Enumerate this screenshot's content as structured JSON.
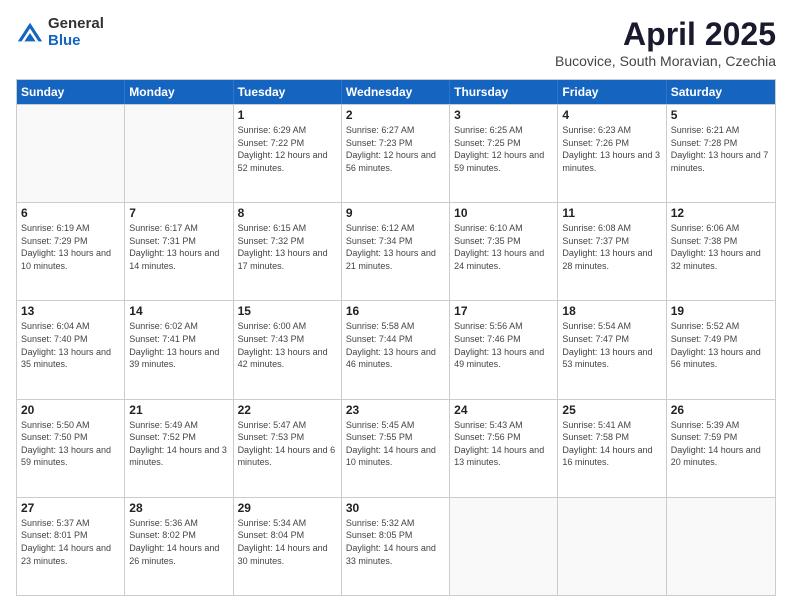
{
  "logo": {
    "general": "General",
    "blue": "Blue"
  },
  "title": "April 2025",
  "location": "Bucovice, South Moravian, Czechia",
  "days_header": [
    "Sunday",
    "Monday",
    "Tuesday",
    "Wednesday",
    "Thursday",
    "Friday",
    "Saturday"
  ],
  "weeks": [
    [
      {
        "day": "",
        "empty": true
      },
      {
        "day": "",
        "empty": true
      },
      {
        "day": "1",
        "sunrise": "Sunrise: 6:29 AM",
        "sunset": "Sunset: 7:22 PM",
        "daylight": "Daylight: 12 hours and 52 minutes."
      },
      {
        "day": "2",
        "sunrise": "Sunrise: 6:27 AM",
        "sunset": "Sunset: 7:23 PM",
        "daylight": "Daylight: 12 hours and 56 minutes."
      },
      {
        "day": "3",
        "sunrise": "Sunrise: 6:25 AM",
        "sunset": "Sunset: 7:25 PM",
        "daylight": "Daylight: 12 hours and 59 minutes."
      },
      {
        "day": "4",
        "sunrise": "Sunrise: 6:23 AM",
        "sunset": "Sunset: 7:26 PM",
        "daylight": "Daylight: 13 hours and 3 minutes."
      },
      {
        "day": "5",
        "sunrise": "Sunrise: 6:21 AM",
        "sunset": "Sunset: 7:28 PM",
        "daylight": "Daylight: 13 hours and 7 minutes."
      }
    ],
    [
      {
        "day": "6",
        "sunrise": "Sunrise: 6:19 AM",
        "sunset": "Sunset: 7:29 PM",
        "daylight": "Daylight: 13 hours and 10 minutes."
      },
      {
        "day": "7",
        "sunrise": "Sunrise: 6:17 AM",
        "sunset": "Sunset: 7:31 PM",
        "daylight": "Daylight: 13 hours and 14 minutes."
      },
      {
        "day": "8",
        "sunrise": "Sunrise: 6:15 AM",
        "sunset": "Sunset: 7:32 PM",
        "daylight": "Daylight: 13 hours and 17 minutes."
      },
      {
        "day": "9",
        "sunrise": "Sunrise: 6:12 AM",
        "sunset": "Sunset: 7:34 PM",
        "daylight": "Daylight: 13 hours and 21 minutes."
      },
      {
        "day": "10",
        "sunrise": "Sunrise: 6:10 AM",
        "sunset": "Sunset: 7:35 PM",
        "daylight": "Daylight: 13 hours and 24 minutes."
      },
      {
        "day": "11",
        "sunrise": "Sunrise: 6:08 AM",
        "sunset": "Sunset: 7:37 PM",
        "daylight": "Daylight: 13 hours and 28 minutes."
      },
      {
        "day": "12",
        "sunrise": "Sunrise: 6:06 AM",
        "sunset": "Sunset: 7:38 PM",
        "daylight": "Daylight: 13 hours and 32 minutes."
      }
    ],
    [
      {
        "day": "13",
        "sunrise": "Sunrise: 6:04 AM",
        "sunset": "Sunset: 7:40 PM",
        "daylight": "Daylight: 13 hours and 35 minutes."
      },
      {
        "day": "14",
        "sunrise": "Sunrise: 6:02 AM",
        "sunset": "Sunset: 7:41 PM",
        "daylight": "Daylight: 13 hours and 39 minutes."
      },
      {
        "day": "15",
        "sunrise": "Sunrise: 6:00 AM",
        "sunset": "Sunset: 7:43 PM",
        "daylight": "Daylight: 13 hours and 42 minutes."
      },
      {
        "day": "16",
        "sunrise": "Sunrise: 5:58 AM",
        "sunset": "Sunset: 7:44 PM",
        "daylight": "Daylight: 13 hours and 46 minutes."
      },
      {
        "day": "17",
        "sunrise": "Sunrise: 5:56 AM",
        "sunset": "Sunset: 7:46 PM",
        "daylight": "Daylight: 13 hours and 49 minutes."
      },
      {
        "day": "18",
        "sunrise": "Sunrise: 5:54 AM",
        "sunset": "Sunset: 7:47 PM",
        "daylight": "Daylight: 13 hours and 53 minutes."
      },
      {
        "day": "19",
        "sunrise": "Sunrise: 5:52 AM",
        "sunset": "Sunset: 7:49 PM",
        "daylight": "Daylight: 13 hours and 56 minutes."
      }
    ],
    [
      {
        "day": "20",
        "sunrise": "Sunrise: 5:50 AM",
        "sunset": "Sunset: 7:50 PM",
        "daylight": "Daylight: 13 hours and 59 minutes."
      },
      {
        "day": "21",
        "sunrise": "Sunrise: 5:49 AM",
        "sunset": "Sunset: 7:52 PM",
        "daylight": "Daylight: 14 hours and 3 minutes."
      },
      {
        "day": "22",
        "sunrise": "Sunrise: 5:47 AM",
        "sunset": "Sunset: 7:53 PM",
        "daylight": "Daylight: 14 hours and 6 minutes."
      },
      {
        "day": "23",
        "sunrise": "Sunrise: 5:45 AM",
        "sunset": "Sunset: 7:55 PM",
        "daylight": "Daylight: 14 hours and 10 minutes."
      },
      {
        "day": "24",
        "sunrise": "Sunrise: 5:43 AM",
        "sunset": "Sunset: 7:56 PM",
        "daylight": "Daylight: 14 hours and 13 minutes."
      },
      {
        "day": "25",
        "sunrise": "Sunrise: 5:41 AM",
        "sunset": "Sunset: 7:58 PM",
        "daylight": "Daylight: 14 hours and 16 minutes."
      },
      {
        "day": "26",
        "sunrise": "Sunrise: 5:39 AM",
        "sunset": "Sunset: 7:59 PM",
        "daylight": "Daylight: 14 hours and 20 minutes."
      }
    ],
    [
      {
        "day": "27",
        "sunrise": "Sunrise: 5:37 AM",
        "sunset": "Sunset: 8:01 PM",
        "daylight": "Daylight: 14 hours and 23 minutes."
      },
      {
        "day": "28",
        "sunrise": "Sunrise: 5:36 AM",
        "sunset": "Sunset: 8:02 PM",
        "daylight": "Daylight: 14 hours and 26 minutes."
      },
      {
        "day": "29",
        "sunrise": "Sunrise: 5:34 AM",
        "sunset": "Sunset: 8:04 PM",
        "daylight": "Daylight: 14 hours and 30 minutes."
      },
      {
        "day": "30",
        "sunrise": "Sunrise: 5:32 AM",
        "sunset": "Sunset: 8:05 PM",
        "daylight": "Daylight: 14 hours and 33 minutes."
      },
      {
        "day": "",
        "empty": true
      },
      {
        "day": "",
        "empty": true
      },
      {
        "day": "",
        "empty": true
      }
    ]
  ]
}
